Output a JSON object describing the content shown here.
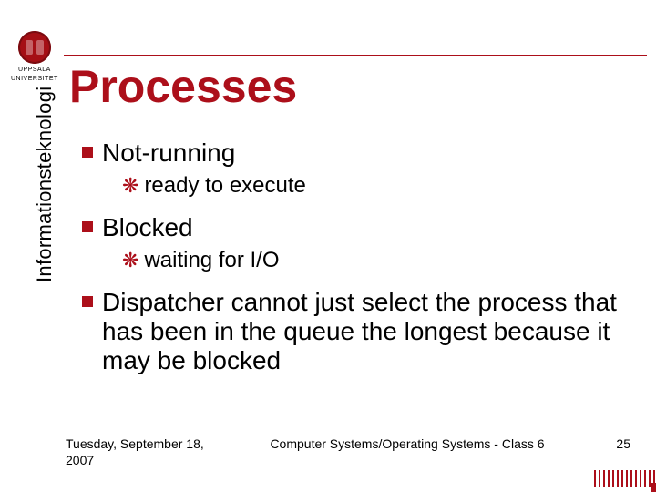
{
  "brand": {
    "line1": "UPPSALA",
    "line2": "UNIVERSITET"
  },
  "vertical_label": "Informationsteknologi",
  "title": "Processes",
  "bullets": [
    {
      "text": "Not-running",
      "sub": {
        "text": "ready to execute"
      }
    },
    {
      "text": "Blocked",
      "sub": {
        "text": "waiting for I/O"
      }
    },
    {
      "text": "Dispatcher cannot just select the process that has been in the queue the longest because it may be blocked"
    }
  ],
  "footer": {
    "date": "Tuesday, September 18, 2007",
    "center": "Computer Systems/Operating Systems - Class 6",
    "page": "25"
  }
}
